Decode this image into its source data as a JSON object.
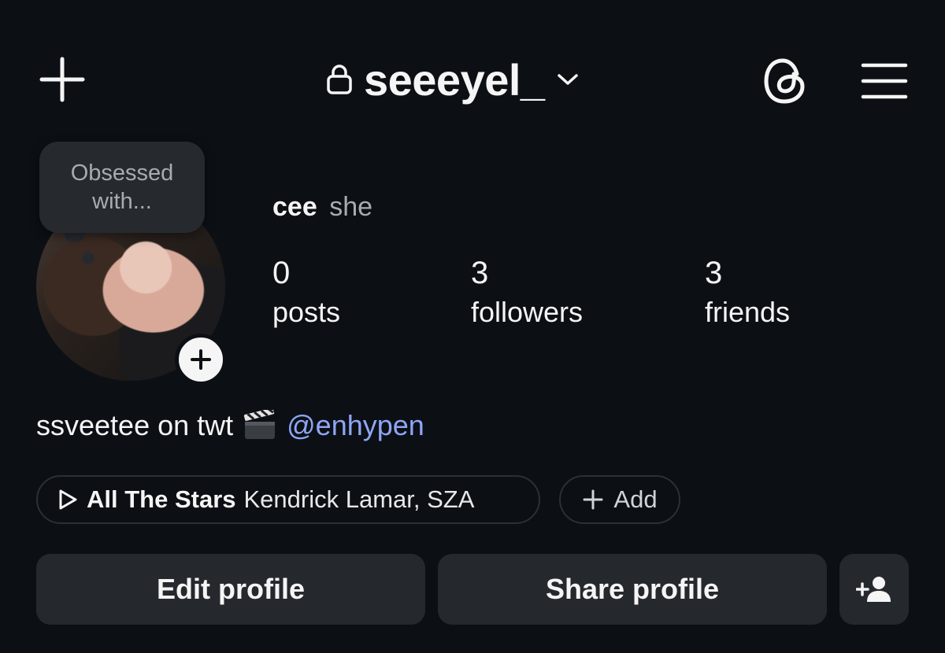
{
  "header": {
    "username": "seeeyel_",
    "icons": [
      "plus-icon",
      "lock-icon",
      "chevron-down-icon",
      "threads-icon",
      "hamburger-menu-icon"
    ]
  },
  "note": {
    "text": "Obsessed with..."
  },
  "profile": {
    "display_name": "cee",
    "pronouns": "she",
    "stats": [
      {
        "count": "0",
        "label": "posts"
      },
      {
        "count": "3",
        "label": "followers"
      },
      {
        "count": "3",
        "label": "friends"
      }
    ],
    "bio": {
      "text": "ssveetee on twt",
      "mention": "@enhypen"
    }
  },
  "music": {
    "title": "All The Stars",
    "artist": "Kendrick Lamar, SZA",
    "add_label": "Add"
  },
  "actions": {
    "edit": "Edit profile",
    "share": "Share profile"
  },
  "colors": {
    "background": "#0c1014",
    "mention": "#8ea6f5",
    "button": "#25292e"
  }
}
